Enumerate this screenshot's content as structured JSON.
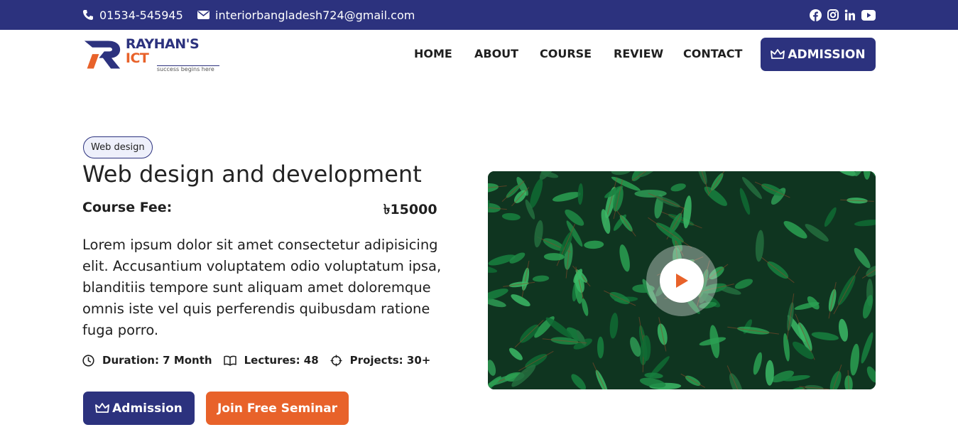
{
  "topbar": {
    "phone": "01534-545945",
    "email": "interiorbangladesh724@gmail.com",
    "phone_icon": "phone-icon",
    "email_icon": "envelope-icon",
    "social": [
      "facebook-icon",
      "instagram-icon",
      "linkedin-icon",
      "youtube-icon"
    ]
  },
  "header": {
    "logo": {
      "brand_main": "RAYHAN'S",
      "brand_accent": "ICT",
      "tagline": "success begins here"
    },
    "nav": [
      "HOME",
      "ABOUT",
      "COURSE",
      "REVIEW",
      "CONTACT"
    ],
    "admission_label": "ADMISSION"
  },
  "course": {
    "badge": "Web design",
    "title": "Web design and development",
    "fee_label": "Course Fee:",
    "fee_value": "৳15000",
    "description": "Lorem ipsum dolor sit amet consectetur adipisicing elit. Accusantium voluptatem odio voluptatum ipsa, blanditiis tempore sunt aliquam amet doloremque omnis iste vel quis perferendis quibusdam ratione fuga porro.",
    "stats": {
      "duration": "Duration: 7 Month",
      "lectures": "Lectures: 48",
      "projects": "Projects: 30+"
    },
    "buttons": {
      "admission": "Admission",
      "seminar": "Join Free Seminar"
    }
  },
  "colors": {
    "primary": "#2c327e",
    "accent": "#e8622a",
    "video_bg": "#123a22",
    "leaf": "#1f8a45"
  }
}
